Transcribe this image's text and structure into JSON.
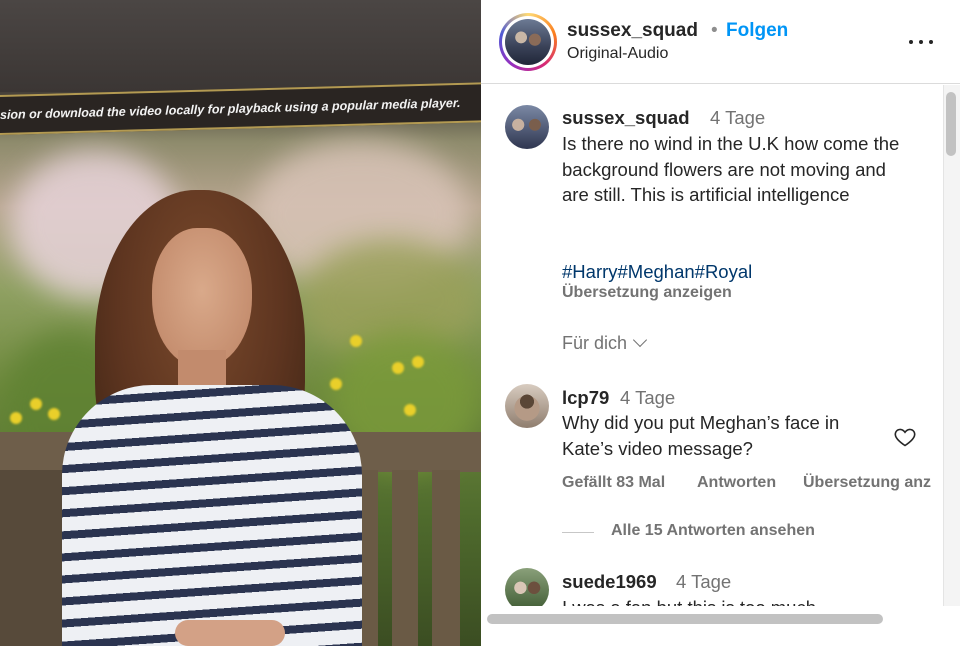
{
  "video": {
    "notice_text": "sion or download the video locally for playback using a popular media player."
  },
  "post": {
    "username": "sussex_squad",
    "separator": "•",
    "follow_label": "Folgen",
    "audio_label": "Original-Audio",
    "more_icon": "more-options-icon"
  },
  "comments": [
    {
      "username": "sussex_squad",
      "time": "4 Tage",
      "text": "Is there no wind in the U.K how come the background flowers are not moving and are still. This is artificial intelligence",
      "hashtags": "#Harry#Meghan#Royal",
      "translate_label": "Übersetzung anzeigen",
      "for_you_label": "Für dich"
    },
    {
      "username": "lcp79",
      "time": "4 Tage",
      "text": "Why did you put Meghan’s face in Kate’s video message?",
      "likes_label": "Gefällt 83 Mal",
      "reply_label": "Antworten",
      "translate_label": "Übersetzung anz",
      "view_replies_label": "Alle 15 Antworten ansehen"
    },
    {
      "username": "suede1969",
      "time": "4 Tage",
      "text": "I was a fan but this is too much"
    }
  ],
  "colors": {
    "link_blue": "#0095f6",
    "hashtag": "#00376b",
    "secondary_text": "#737373"
  }
}
